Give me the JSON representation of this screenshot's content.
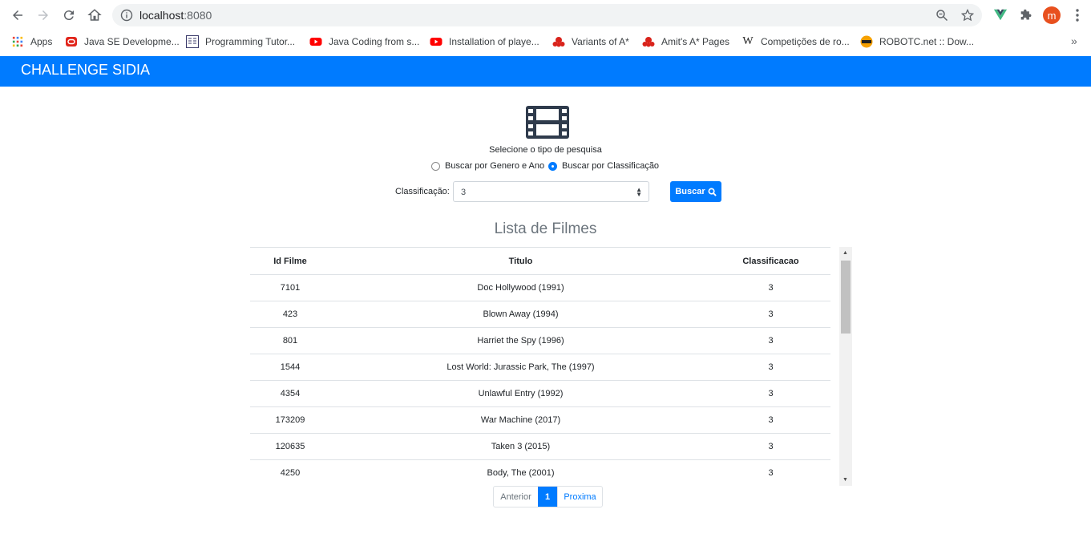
{
  "browser": {
    "url_host": "localhost",
    "url_port": ":8080",
    "avatar_letter": "m",
    "bookmarks": [
      {
        "label": "Apps",
        "icon": "apps-grid-icon"
      },
      {
        "label": "Java SE Developme...",
        "icon": "oracle-icon"
      },
      {
        "label": "Programming Tutor...",
        "icon": "tutorial-icon"
      },
      {
        "label": "Java Coding from s...",
        "icon": "youtube-icon"
      },
      {
        "label": "Installation of playe...",
        "icon": "youtube-icon"
      },
      {
        "label": "Variants of A*",
        "icon": "red-blob-icon"
      },
      {
        "label": "Amit's A* Pages",
        "icon": "red-blob-icon"
      },
      {
        "label": "Competições de ro...",
        "icon": "wikipedia-icon"
      },
      {
        "label": "ROBOTC.net :: Dow...",
        "icon": "robotc-icon"
      }
    ],
    "more": "»"
  },
  "app": {
    "title": "CHALLENGE SIDIA"
  },
  "search": {
    "type_label": "Selecione o tipo de pesquisa",
    "option_genre_year": "Buscar por Genero e Ano",
    "option_classification": "Buscar por Classificação",
    "selected_option": "classification",
    "classification_label": "Classificação:",
    "classification_value": "3",
    "search_button": "Buscar"
  },
  "list": {
    "title": "Lista de Filmes",
    "headers": [
      "Id Filme",
      "Titulo",
      "Classificacao"
    ],
    "rows": [
      [
        "7101",
        "Doc Hollywood (1991)",
        "3"
      ],
      [
        "423",
        "Blown Away (1994)",
        "3"
      ],
      [
        "801",
        "Harriet the Spy (1996)",
        "3"
      ],
      [
        "1544",
        "Lost World: Jurassic Park, The (1997)",
        "3"
      ],
      [
        "4354",
        "Unlawful Entry (1992)",
        "3"
      ],
      [
        "173209",
        "War Machine (2017)",
        "3"
      ],
      [
        "120635",
        "Taken 3 (2015)",
        "3"
      ],
      [
        "4250",
        "Body, The (2001)",
        "3"
      ]
    ]
  },
  "pagination": {
    "prev": "Anterior",
    "current": "1",
    "next": "Proxima"
  },
  "colors": {
    "primary": "#007bff",
    "muted": "#6c757d",
    "film_icon": "#2f3b4c"
  }
}
